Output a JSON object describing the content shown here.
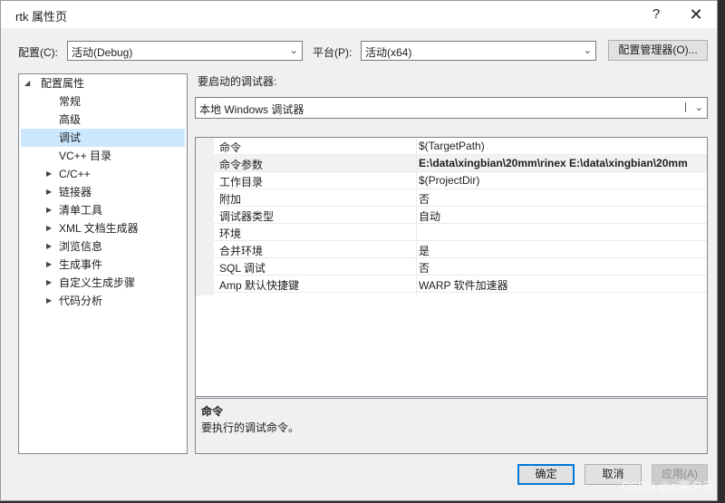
{
  "window": {
    "title": "rtk 属性页",
    "help_glyph": "?",
    "close_glyph": "✕"
  },
  "config": {
    "label": "配置(C):",
    "value": "活动(Debug)"
  },
  "platform": {
    "label": "平台(P):",
    "value": "活动(x64)"
  },
  "config_manager_label": "配置管理器(O)...",
  "tree": {
    "root": "配置属性",
    "items": [
      {
        "label": "常规",
        "expandable": false
      },
      {
        "label": "高级",
        "expandable": false
      },
      {
        "label": "调试",
        "expandable": false,
        "selected": true
      },
      {
        "label": "VC++ 目录",
        "expandable": false
      },
      {
        "label": "C/C++",
        "expandable": true
      },
      {
        "label": "链接器",
        "expandable": true
      },
      {
        "label": "清单工具",
        "expandable": true
      },
      {
        "label": "XML 文档生成器",
        "expandable": true
      },
      {
        "label": "浏览信息",
        "expandable": true
      },
      {
        "label": "生成事件",
        "expandable": true
      },
      {
        "label": "自定义生成步骤",
        "expandable": true
      },
      {
        "label": "代码分析",
        "expandable": true
      }
    ]
  },
  "debugger": {
    "label": "要启动的调试器:",
    "value": "本地 Windows 调试器"
  },
  "properties": [
    {
      "name": "命令",
      "value": "$(TargetPath)"
    },
    {
      "name": "命令参数",
      "value": "E:\\data\\xingbian\\20mm\\rinex  E:\\data\\xingbian\\20mm",
      "bold": true
    },
    {
      "name": "工作目录",
      "value": "$(ProjectDir)"
    },
    {
      "name": "附加",
      "value": "否"
    },
    {
      "name": "调试器类型",
      "value": "自动"
    },
    {
      "name": "环境",
      "value": ""
    },
    {
      "name": "合并环境",
      "value": "是"
    },
    {
      "name": "SQL 调试",
      "value": "否"
    },
    {
      "name": "Amp 默认快捷键",
      "value": "WARP 软件加速器"
    }
  ],
  "description": {
    "title": "命令",
    "text": "要执行的调试命令。"
  },
  "buttons": {
    "ok": "确定",
    "cancel": "取消",
    "apply": "应用(A)"
  },
  "watermark": "CSDN @zi紫夕云"
}
